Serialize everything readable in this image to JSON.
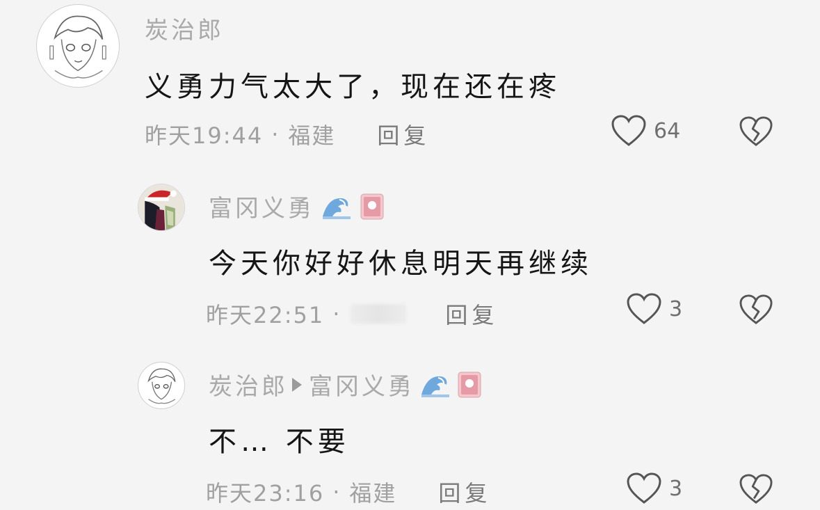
{
  "comments": [
    {
      "author": "炭治郎",
      "text": "义勇力气太大了，现在还在疼",
      "time": "昨天19:44",
      "separator": "·",
      "location": "福建",
      "reply_label": "回复",
      "likes": "64"
    },
    {
      "author": "富冈义勇",
      "text": "今天你好好休息明天再继续",
      "time": "昨天22:51",
      "separator": "·",
      "reply_label": "回复",
      "likes": "3"
    },
    {
      "author": "炭治郎",
      "reply_to": "富冈义勇",
      "text": "不… 不要",
      "time": "昨天23:16",
      "separator": "·",
      "location": "福建",
      "reply_label": "回复",
      "likes": "3"
    }
  ],
  "icons": {
    "like": "heart-outline-icon",
    "dislike": "broken-heart-icon",
    "wave": "wave-emoji-icon",
    "badge": "sun-card-emoji-icon",
    "arrow": "reply-arrow-icon"
  },
  "colors": {
    "background": "#f4f4f4",
    "name": "#a9a9a9",
    "body_text": "#151515",
    "meta_text": "#a0a0a0",
    "icon_stroke": "#555555"
  }
}
